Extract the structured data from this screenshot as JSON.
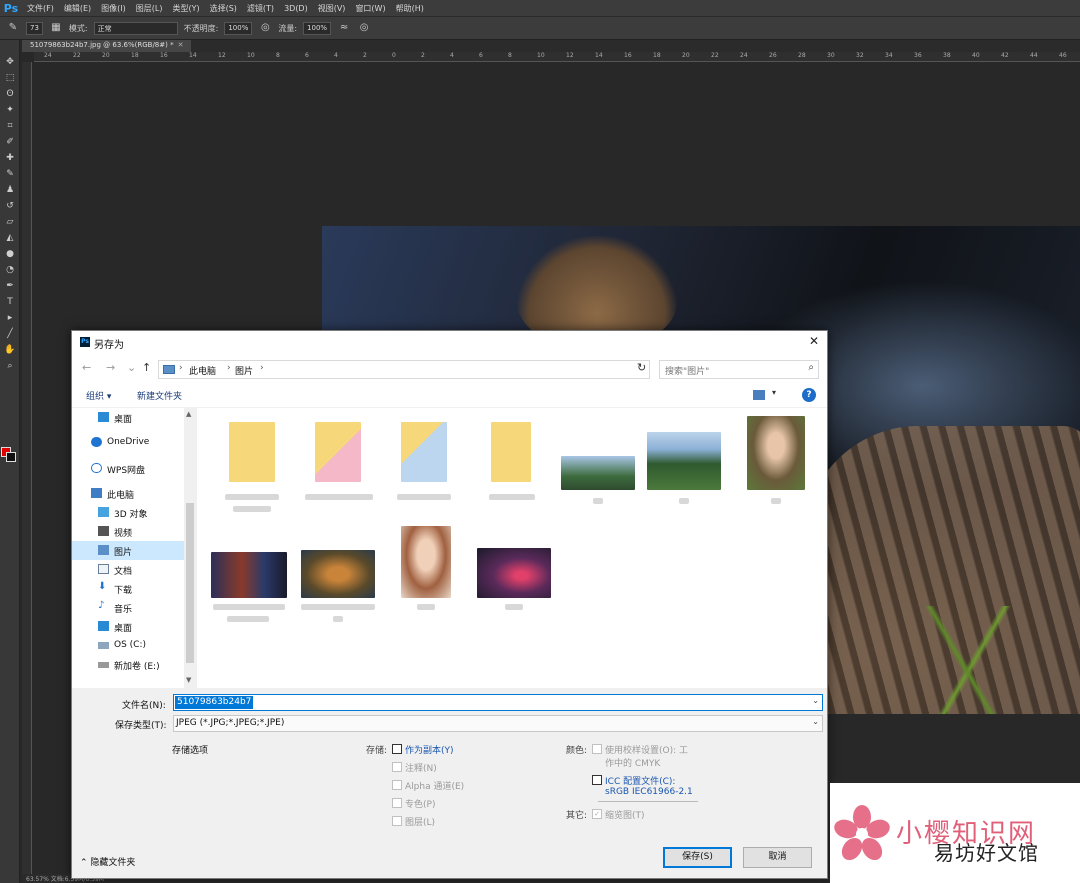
{
  "app": {
    "logo": "Ps",
    "menu": [
      "文件(F)",
      "编辑(E)",
      "图像(I)",
      "图层(L)",
      "类型(Y)",
      "选择(S)",
      "滤镜(T)",
      "3D(D)",
      "视图(V)",
      "窗口(W)",
      "帮助(H)"
    ]
  },
  "options_bar": {
    "brush_size": "73",
    "mode_label": "模式:",
    "mode_value": "正常",
    "opacity_label": "不透明度:",
    "opacity_value": "100%",
    "flow_label": "流量:",
    "flow_value": "100%"
  },
  "document": {
    "tab_title": "51079863b24b7.jpg @ 63.6%(RGB/8#) *",
    "ruler_ticks": [
      "24",
      "22",
      "20",
      "18",
      "16",
      "14",
      "12",
      "10",
      "8",
      "6",
      "4",
      "2",
      "0",
      "2",
      "4",
      "6",
      "8",
      "10",
      "12",
      "14",
      "16",
      "18",
      "20",
      "22",
      "24",
      "26",
      "28",
      "30",
      "32",
      "34",
      "36",
      "38",
      "40",
      "42",
      "44",
      "46"
    ],
    "status": "63.57%    文档:6.59M/6.59M"
  },
  "dialog": {
    "title": "另存为",
    "close_label": "✕",
    "address": {
      "root": "此电脑",
      "folder": "图片"
    },
    "search_placeholder": "搜索\"图片\"",
    "organize_label": "组织 ▾",
    "new_folder_label": "新建文件夹",
    "help_label": "?",
    "nav_items": [
      {
        "label": "桌面",
        "icon": "desktop-icon"
      },
      {
        "label": "OneDrive",
        "icon": "cloud-icon"
      },
      {
        "label": "WPS网盘",
        "icon": "cloud-outline-icon"
      },
      {
        "label": "此电脑",
        "icon": "computer-icon"
      },
      {
        "label": "3D 对象",
        "icon": "cube-icon"
      },
      {
        "label": "视频",
        "icon": "video-icon"
      },
      {
        "label": "图片",
        "icon": "pictures-icon",
        "selected": true
      },
      {
        "label": "文档",
        "icon": "document-icon"
      },
      {
        "label": "下载",
        "icon": "download-icon"
      },
      {
        "label": "音乐",
        "icon": "music-icon"
      },
      {
        "label": "桌面",
        "icon": "desktop-icon"
      },
      {
        "label": "OS (C:)",
        "icon": "drive-icon"
      },
      {
        "label": "新加卷 (E:)",
        "icon": "drive-icon"
      }
    ],
    "file_name_label": "文件名(N):",
    "file_name_value": "51079863b24b7",
    "file_type_label": "保存类型(T):",
    "file_type_value": "JPEG (*.JPG;*.JPEG;*.JPE)",
    "save_options_label": "存储选项",
    "storage_label": "存储:",
    "storage_options": [
      {
        "label": "作为副本(Y)",
        "enabled": true
      },
      {
        "label": "注释(N)",
        "enabled": false
      },
      {
        "label": "Alpha 通道(E)",
        "enabled": false
      },
      {
        "label": "专色(P)",
        "enabled": false
      },
      {
        "label": "图层(L)",
        "enabled": false
      }
    ],
    "color_label": "颜色:",
    "proof_label_1": "使用校样设置(O): 工",
    "proof_label_2": "作中的 CMYK",
    "icc_label": "ICC 配置文件(C):",
    "icc_value": "sRGB IEC61966-2.1",
    "other_label": "其它:",
    "thumbnail_label": "缩览图(T)",
    "hide_folders_label": "隐藏文件夹",
    "save_button": "保存(S)",
    "cancel_button": "取消"
  },
  "watermark": {
    "title": "小樱知识网",
    "subtitle": "易坊好文馆"
  },
  "colors": {
    "accent": "#0078d7",
    "foreground_swatch": "#e00000",
    "background_swatch": "#111111"
  }
}
